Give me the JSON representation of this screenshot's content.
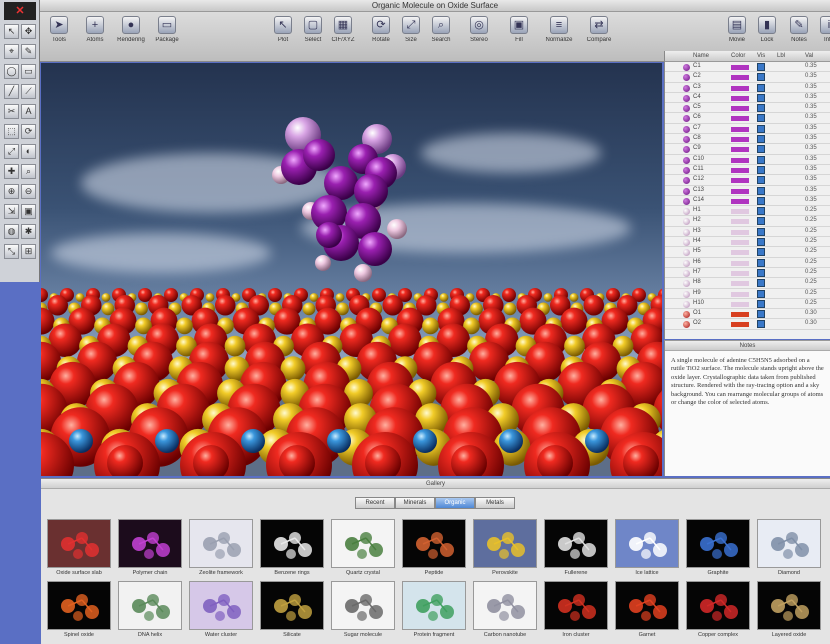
{
  "window": {
    "title": "Organic Molecule on Oxide Surface"
  },
  "palette": {
    "logo": "✕"
  },
  "toolbar": {
    "buttons": [
      {
        "label": "Tools",
        "icon": "arrow-icon"
      },
      {
        "label": "Atoms",
        "icon": "plus-icon"
      },
      {
        "label": "Rendering",
        "icon": "sphere-icon"
      },
      {
        "label": "Package",
        "icon": "box-icon"
      },
      {
        "label": "Plot",
        "icon": "pointer-icon"
      },
      {
        "label": "Select",
        "icon": "select-icon"
      },
      {
        "label": "CIF/XYZ",
        "icon": "grid-icon"
      },
      {
        "label": "Rotate",
        "icon": "rotate-icon"
      },
      {
        "label": "Size",
        "icon": "size-icon"
      },
      {
        "label": "Search",
        "icon": "search-icon"
      },
      {
        "label": "Stereo",
        "icon": "stereo-icon"
      },
      {
        "label": "Fill",
        "icon": "fill-icon"
      },
      {
        "label": "Normalize",
        "icon": "normalize-icon"
      },
      {
        "label": "Compare",
        "icon": "compare-icon"
      },
      {
        "label": "Movie",
        "icon": "folder-icon"
      },
      {
        "label": "Lock",
        "icon": "lock-icon"
      },
      {
        "label": "Notes",
        "icon": "notes-icon"
      },
      {
        "label": "Info",
        "icon": "info-icon"
      }
    ]
  },
  "atom_list": {
    "head": [
      "Name",
      "Color",
      "Vis",
      "Lbl",
      "Val"
    ],
    "rows": [
      {
        "name": "C1",
        "val": "0.35"
      },
      {
        "name": "C2",
        "val": "0.35"
      },
      {
        "name": "C3",
        "val": "0.35"
      },
      {
        "name": "C4",
        "val": "0.35"
      },
      {
        "name": "C5",
        "val": "0.35"
      },
      {
        "name": "C6",
        "val": "0.35"
      },
      {
        "name": "C7",
        "val": "0.35"
      },
      {
        "name": "C8",
        "val": "0.35"
      },
      {
        "name": "C9",
        "val": "0.35"
      },
      {
        "name": "C10",
        "val": "0.35"
      },
      {
        "name": "C11",
        "val": "0.35"
      },
      {
        "name": "C12",
        "val": "0.35"
      },
      {
        "name": "C13",
        "val": "0.35"
      },
      {
        "name": "C14",
        "val": "0.35"
      },
      {
        "name": "H1",
        "val": "0.25"
      },
      {
        "name": "H2",
        "val": "0.25"
      },
      {
        "name": "H3",
        "val": "0.25"
      },
      {
        "name": "H4",
        "val": "0.25"
      },
      {
        "name": "H5",
        "val": "0.25"
      },
      {
        "name": "H6",
        "val": "0.25"
      },
      {
        "name": "H7",
        "val": "0.25"
      },
      {
        "name": "H8",
        "val": "0.25"
      },
      {
        "name": "H9",
        "val": "0.25"
      },
      {
        "name": "H10",
        "val": "0.25"
      },
      {
        "name": "O1",
        "val": "0.30"
      },
      {
        "name": "O2",
        "val": "0.30"
      }
    ]
  },
  "notes": {
    "title": "Notes",
    "text": "A single molecule of adenine C5H5N5 adsorbed on a rutile TiO2 surface. The molecule stands upright above the oxide layer. Crystallographic data taken from published structure. Rendered with the ray-tracing option and a sky background. You can rearrange molecular groups of atoms or change the color of selected atoms."
  },
  "gallery": {
    "title": "Gallery",
    "tabs": [
      {
        "label": "Recent",
        "active": false
      },
      {
        "label": "Minerals",
        "active": false
      },
      {
        "label": "Organic",
        "active": true
      },
      {
        "label": "Metals",
        "active": false
      }
    ],
    "items": [
      {
        "caption": "Oxide surface slab",
        "bg": "#6a3030"
      },
      {
        "caption": "Polymer chain",
        "bg": "#1c0c1c"
      },
      {
        "caption": "Zeolite framework",
        "bg": "#e6e6ee"
      },
      {
        "caption": "Benzene rings",
        "bg": "#050505"
      },
      {
        "caption": "Quartz crystal",
        "bg": "#f4f4f4"
      },
      {
        "caption": "Peptide",
        "bg": "#050505"
      },
      {
        "caption": "Perovskite",
        "bg": "#5e6e9e"
      },
      {
        "caption": "Fullerene",
        "bg": "#050505"
      },
      {
        "caption": "Ice lattice",
        "bg": "#6f86c8"
      },
      {
        "caption": "Graphite",
        "bg": "#050505"
      },
      {
        "caption": "Diamond",
        "bg": "#e8ecf4"
      },
      {
        "caption": "Spinel oxide",
        "bg": "#050505"
      },
      {
        "caption": "DNA helix",
        "bg": "#f2f2f2"
      },
      {
        "caption": "Water cluster",
        "bg": "#d6c8e8"
      },
      {
        "caption": "Silicate",
        "bg": "#050505"
      },
      {
        "caption": "Sugar molecule",
        "bg": "#f4f4f4"
      },
      {
        "caption": "Protein fragment",
        "bg": "#d4e4ec"
      },
      {
        "caption": "Carbon nanotube",
        "bg": "#f4f4f4"
      },
      {
        "caption": "Iron cluster",
        "bg": "#050505"
      },
      {
        "caption": "Garnet",
        "bg": "#050505"
      },
      {
        "caption": "Copper complex",
        "bg": "#050505"
      },
      {
        "caption": "Layered oxide",
        "bg": "#050505"
      }
    ]
  },
  "colors": {
    "molecule": "#9a2ab0",
    "oxygen": "#d01818",
    "titanium": "#e8c02a",
    "nitrogen": "#2a7fd0"
  }
}
